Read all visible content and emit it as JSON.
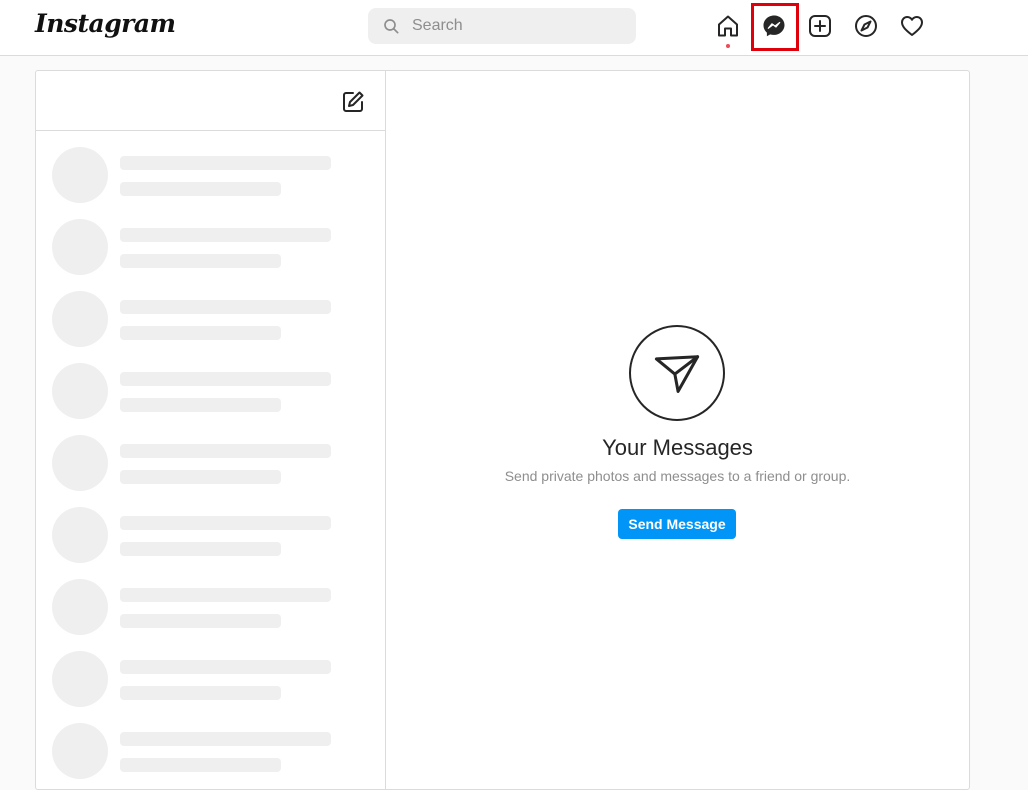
{
  "app": {
    "logo_text": "Instagram"
  },
  "search": {
    "placeholder": "Search",
    "value": ""
  },
  "nav": {
    "icons": [
      "home-icon",
      "messenger-icon",
      "new-post-icon",
      "explore-icon",
      "activity-heart-icon"
    ],
    "highlighted": "messenger-icon",
    "home_notification_color": "#ed4956",
    "highlight_color": "#e0000c"
  },
  "inbox": {
    "compose_icon": "new-message-icon",
    "placeholder_rows": 9
  },
  "empty_state": {
    "icon": "paper-plane-icon",
    "title": "Your Messages",
    "subtitle": "Send private photos and messages to a friend or group.",
    "button_label": "Send Message",
    "button_color": "#0095f6"
  }
}
